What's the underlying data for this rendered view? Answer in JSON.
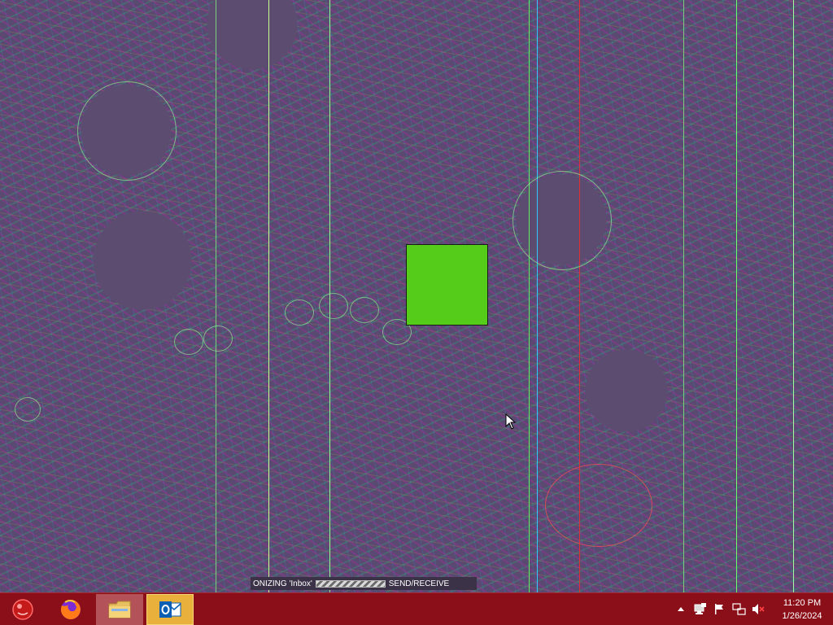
{
  "desktop": {
    "background_color": "#5a4a72",
    "green_square_color": "#55cc1a"
  },
  "outlook_status": {
    "activity_text": "ONIZING 'Inbox'",
    "send_receive_label": "SEND/RECEIVE",
    "progress_state": "indeterminate"
  },
  "taskbar": {
    "color": "#8b0f18",
    "start_button": {
      "icon": "start-orb-icon"
    },
    "pinned": [
      {
        "name": "Firefox",
        "icon": "firefox-icon"
      },
      {
        "name": "File Explorer",
        "icon": "folder-icon"
      },
      {
        "name": "Outlook",
        "icon": "outlook-icon",
        "active": true,
        "highlight_color": "#e9b13b"
      }
    ],
    "tray": {
      "icons": [
        "chevron-up-icon",
        "network-drive-icon",
        "flag-icon",
        "network-icon",
        "volume-muted-icon"
      ],
      "time": "11:20 PM",
      "date": "1/26/2024"
    }
  }
}
